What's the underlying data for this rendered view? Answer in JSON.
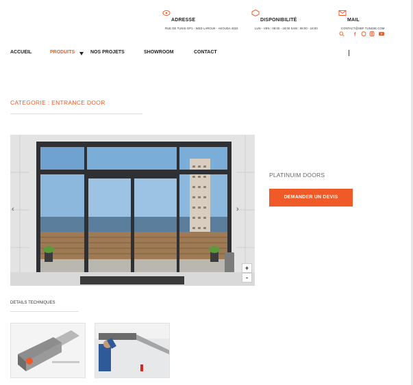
{
  "header": {
    "address": {
      "icon": "map-pin-icon",
      "title": "ADRESSE",
      "value": "RUE DE TUNIS GP1 - WED LAROUK - AKOUDA 4022"
    },
    "availability": {
      "icon": "clock-icon",
      "title": "DISPONIBILITÉ",
      "value": "LUN - VEN : 08:00 - 18:00  SAM : 08:00 - 18:00"
    },
    "mail": {
      "icon": "envelope-icon",
      "title": "MAIL",
      "value": "CONTACT@SBF-TUNISIE.COM"
    },
    "socials": [
      "search-icon",
      "facebook-icon",
      "whatsapp-icon",
      "instagram-icon",
      "youtube-icon"
    ]
  },
  "nav": {
    "items": [
      {
        "label": "ACCUEIL",
        "active": false
      },
      {
        "label": "PRODUITS",
        "active": true
      },
      {
        "label": "NOS PROJETS",
        "active": false
      },
      {
        "label": "SHOWROOM",
        "active": false
      },
      {
        "label": "CONTACT",
        "active": false
      }
    ]
  },
  "category": {
    "label": "CATEGORIE : ENTRANCE DOOR"
  },
  "gallery": {
    "prev": "‹",
    "next": "›",
    "zoom_in": "+",
    "zoom_out": "-"
  },
  "product": {
    "name": "PLATINUIM DOORS",
    "quote_button": "DEMANDER UN DEVIS"
  },
  "details": {
    "title": "DETAILS TECHNIQUES"
  },
  "colors": {
    "accent": "#f05a28",
    "text": "#222222"
  }
}
